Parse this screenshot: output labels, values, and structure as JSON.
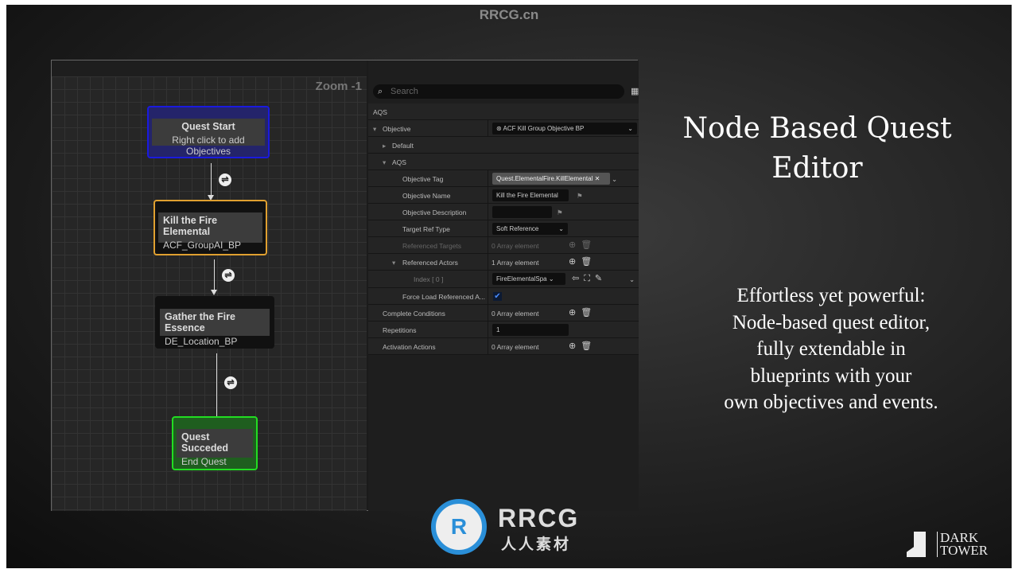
{
  "watermark": "RRCG.cn",
  "graph": {
    "zoom_label": "Zoom -1",
    "nodes": [
      {
        "title": "Quest Start",
        "subtitle": "Right click to add Objectives",
        "color": "#1a1adf"
      },
      {
        "title": "Kill the Fire Elemental",
        "subtitle": "ACF_GroupAI_BP",
        "color": "#e0a030"
      },
      {
        "title": "Gather the Fire Essence",
        "subtitle": "DE_Location_BP",
        "color": "#111111"
      },
      {
        "title": "Quest Succeded",
        "subtitle": "End Quest",
        "color": "#22dd22"
      }
    ],
    "condition_icon": "transition-icon"
  },
  "details": {
    "search_placeholder": "Search",
    "rows": {
      "aqs": "AQS",
      "objective": "Objective",
      "objective_value": "ACF Kill Group Objective BP",
      "default": "Default",
      "aqs2": "AQS",
      "tag": "Objective Tag",
      "tag_value": "Quest.ElementalFire.KillElemental",
      "name": "Objective Name",
      "name_value": "Kill the Fire Elemental",
      "desc": "Objective Description",
      "ref_type": "Target Ref Type",
      "ref_type_value": "Soft Reference",
      "ref_targets": "Referenced Targets",
      "ref_targets_value": "0 Array element",
      "ref_actors": "Referenced Actors",
      "ref_actors_value": "1 Array element",
      "index": "Index [ 0 ]",
      "index_value": "FireElementalSpa",
      "force": "Force Load Referenced A...",
      "force_checked": true,
      "complete": "Complete Conditions",
      "complete_value": "0 Array element",
      "reps": "Repetitions",
      "reps_value": "1",
      "activation": "Activation Actions",
      "activation_value": "0 Array element"
    }
  },
  "slide": {
    "title_line1": "Node Based Quest",
    "title_line2": "Editor",
    "desc": [
      "Effortless yet powerful:",
      "Node-based quest editor,",
      "fully extendable in",
      "blueprints with your",
      "own objectives and events."
    ]
  },
  "logo": {
    "text": "RRCG",
    "sub": "人人素材"
  },
  "brand": {
    "line1": "DARK",
    "line2": "TOWER"
  }
}
